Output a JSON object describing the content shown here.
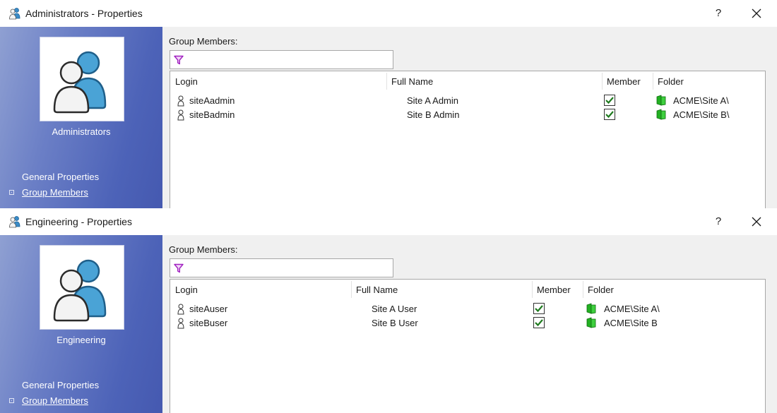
{
  "windows": [
    {
      "title": "Administrators - Properties",
      "help_label": "?",
      "group_name": "Administrators",
      "nav": {
        "general": "General Properties",
        "members": "Group Members"
      },
      "members_label": "Group Members:",
      "filter": {
        "value": "",
        "placeholder": ""
      },
      "columns": {
        "login": "Login",
        "full_name": "Full Name",
        "member": "Member",
        "folder": "Folder"
      },
      "rows": [
        {
          "login": "siteAadmin",
          "full_name": "Site A Admin",
          "member": true,
          "folder": "ACME\\Site A\\"
        },
        {
          "login": "siteBadmin",
          "full_name": "Site B Admin",
          "member": true,
          "folder": "ACME\\Site B\\"
        }
      ]
    },
    {
      "title": "Engineering - Properties",
      "help_label": "?",
      "group_name": "Engineering",
      "nav": {
        "general": "General Properties",
        "members": "Group Members"
      },
      "members_label": "Group Members:",
      "filter": {
        "value": "",
        "placeholder": ""
      },
      "columns": {
        "login": "Login",
        "full_name": "Full Name",
        "member": "Member",
        "folder": "Folder"
      },
      "rows": [
        {
          "login": "siteAuser",
          "full_name": "Site A User",
          "member": true,
          "folder": "ACME\\Site A\\"
        },
        {
          "login": "siteBuser",
          "full_name": "Site B User",
          "member": true,
          "folder": "ACME\\Site B"
        }
      ]
    }
  ],
  "icons": {
    "title": "group-icon",
    "avatar": "users-group-icon",
    "filter": "filter-icon",
    "row_user": "user-icon",
    "member": "checkbox-checked-icon",
    "folder": "folder-icon",
    "close": "close-icon"
  },
  "colors": {
    "sidebar": "#4d63b8",
    "filter_icon": "#a020c0",
    "check": "#1e7a1e",
    "folder": "#22b022"
  }
}
